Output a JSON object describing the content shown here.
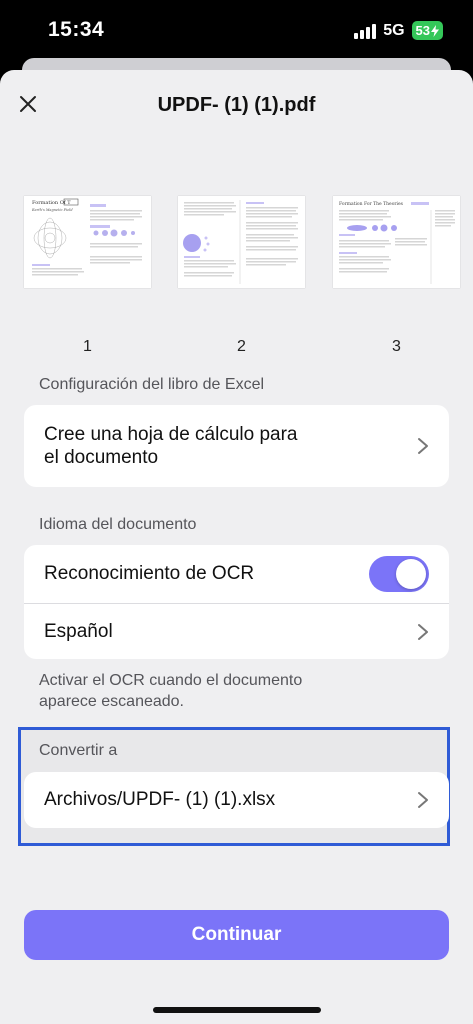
{
  "status_bar": {
    "time": "15:34",
    "network": "5G",
    "battery": "53"
  },
  "header": {
    "title": "UPDF- (1) (1).pdf",
    "close_icon": "close-icon"
  },
  "pages": [
    {
      "number": "1",
      "heading": "Formation Of T",
      "subheading": "Earth's Magnetic Field"
    },
    {
      "number": "2"
    },
    {
      "number": "3",
      "heading": "Formation For The Theories"
    }
  ],
  "excel_section": {
    "label": "Configuración del libro de Excel",
    "option_line1": "Cree una hoja de cálculo para",
    "option_line2": "el documento"
  },
  "language_section": {
    "label": "Idioma del documento",
    "ocr_label": "Reconocimiento de OCR",
    "ocr_enabled": true,
    "language": "Español",
    "note": "Activar el OCR cuando el documento aparece escaneado."
  },
  "convert_section": {
    "label": "Convertir a",
    "path": "Archivos/UPDF- (1) (1).xlsx"
  },
  "continue_label": "Continuar",
  "colors": {
    "accent": "#7b74f8",
    "highlight_border": "#2f5bd6",
    "battery": "#34c759"
  }
}
